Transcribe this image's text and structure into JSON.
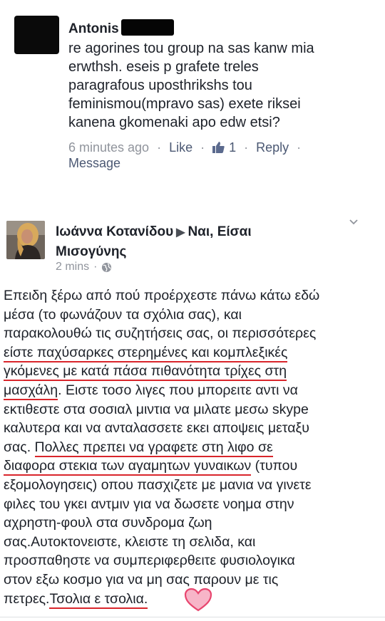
{
  "comment1": {
    "author": "Antonis",
    "text_lines": [
      "re agorines tou group na sas kanw mia",
      "erwthsh. eseis p grafete treles",
      "paragrafous uposthrikshs tou",
      "feminismou(mpravo sas) exete riksei",
      "kanena gkomenaki apo edw etsi?"
    ],
    "meta": {
      "time": "6 minutes ago",
      "like_label": "Like",
      "like_count": "1",
      "reply_label": "Reply",
      "message_label": "Message"
    }
  },
  "comment2": {
    "author": "Ιωάννα Κοτανίδου",
    "target": "Ναι, Είσαι",
    "target_line2": "Μισογύνης",
    "time": "2 mins",
    "body_lines": [
      {
        "segments": [
          {
            "text": "Επειδη ξέρω από πού προέρχεστε πάνω κάτω εδώ",
            "u": false
          }
        ]
      },
      {
        "segments": [
          {
            "text": "μέσα (το φωνάζουν τα σχόλια σας), και",
            "u": false
          }
        ]
      },
      {
        "segments": [
          {
            "text": "παρακολουθώ τις συζητήσεις σας, οι περισσότερες",
            "u": false
          }
        ]
      },
      {
        "segments": [
          {
            "text": "είστε παχύσαρκες στερημένες και κομπλεξικές",
            "u": true
          }
        ]
      },
      {
        "segments": [
          {
            "text": "γκόμενες με κατά πάσα πιθανότητα τρίχες στη",
            "u": true
          }
        ]
      },
      {
        "segments": [
          {
            "text": "μασχάλη",
            "u": true
          },
          {
            "text": ". Ειστε τοσο λιγες που μπορειτε αντι να",
            "u": false
          }
        ]
      },
      {
        "segments": [
          {
            "text": "εκτιθεστε στα σοσιαλ μιντια να μιλατε μεσω skype",
            "u": false
          }
        ]
      },
      {
        "segments": [
          {
            "text": "καλυτερα και να ανταλασσετε εκει αποψεις μεταξυ",
            "u": false
          }
        ]
      },
      {
        "segments": [
          {
            "text": "σας. ",
            "u": false
          },
          {
            "text": "Πολλες πρεπει να γραφετε στη λιφο σε",
            "u": true
          }
        ]
      },
      {
        "segments": [
          {
            "text": "διαφορα στεκια των αγαμητων γυναικων",
            "u": true
          },
          {
            "text": " (τυπου",
            "u": false
          }
        ]
      },
      {
        "segments": [
          {
            "text": "εξομολογησεις) οπου πασχιζετε με μανια να γινετε",
            "u": false
          }
        ]
      },
      {
        "segments": [
          {
            "text": "φιλες του γκει αντμιν για να δωσετε νοημα στην",
            "u": false
          }
        ]
      },
      {
        "segments": [
          {
            "text": "αχρηστη-φουλ στα συνδρομα ζωη",
            "u": false
          }
        ]
      },
      {
        "segments": [
          {
            "text": "σας.Αυτοκτονειστε, κλειστε τη σελιδα, και",
            "u": false
          }
        ]
      },
      {
        "segments": [
          {
            "text": "προσπαθηστε να συμπεριφερθειτε φυσιολογικα",
            "u": false
          }
        ]
      },
      {
        "segments": [
          {
            "text": "στον εξω κοσμο για να μη σας παρουν με τις",
            "u": false
          }
        ]
      },
      {
        "segments": [
          {
            "text": "πετρες.",
            "u": false
          },
          {
            "text": "Τσολια ε τσολια.",
            "u": true
          }
        ]
      }
    ]
  },
  "colors": {
    "underline": "#d9252b",
    "heart_fill": "#f7b5c8",
    "heart_stroke": "#e8466f",
    "meta_gray": "#90949c",
    "link_blue": "#4b5873"
  },
  "icons": [
    "thumbs-up-icon",
    "globe-icon",
    "chevron-down-icon",
    "heart-icon",
    "play-arrow-icon"
  ]
}
